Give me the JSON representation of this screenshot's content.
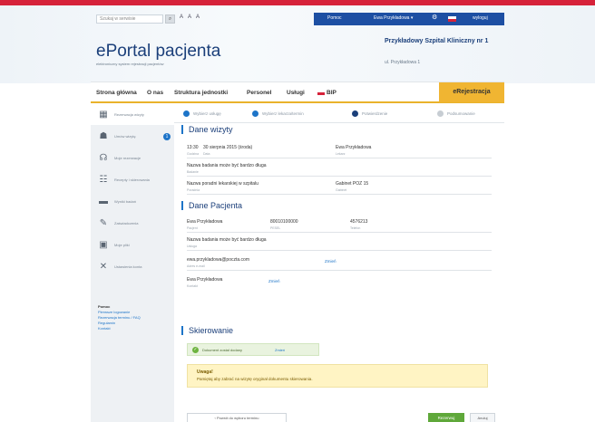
{
  "topbar": {
    "search_placeholder": "Szukaj w serwisie",
    "font_controls": "A  A  A",
    "help_label": "Pomoc",
    "user_label": "Ewa Przykładowa  ▾",
    "logout_label": "wyloguj"
  },
  "header": {
    "title": "ePortal pacjenta",
    "subtitle": "elektroniczny system rejestracji pacjentów",
    "hospital_name": "Przykładowy Szpital Kliniczny nr 1",
    "hospital_address": "ul. Przykładowa 1"
  },
  "nav": {
    "items": [
      "Strona główna",
      "O nas",
      "Struktura jednostki",
      "Personel",
      "Usługi",
      "BIP"
    ],
    "registration": "eRejestracja"
  },
  "sidebar": {
    "items": [
      {
        "label": "Rezerwacja wizyty",
        "icon": "calendar-icon"
      },
      {
        "label": "Umów wizytę",
        "icon": "doctor-icon",
        "badge": "1"
      },
      {
        "label": "Moje rezerwacje",
        "icon": "stethoscope-icon"
      },
      {
        "label": "Recepty i skierowania",
        "icon": "prescription-icon"
      },
      {
        "label": "Wyniki badań",
        "icon": "folder-icon"
      },
      {
        "label": "Zaświadczenia",
        "icon": "pen-icon"
      },
      {
        "label": "Moje pliki",
        "icon": "files-icon"
      },
      {
        "label": "Ustawienia konta",
        "icon": "tools-icon"
      }
    ],
    "help": {
      "title": "Pomoc",
      "links": [
        "Pierwsze logowanie",
        "Rezerwacja terminu / FAQ",
        "Regulamin",
        "Kontakt"
      ]
    }
  },
  "steps": [
    {
      "label": "Wybierz usługę",
      "state": "done"
    },
    {
      "label": "Wybierz lekarza/termin",
      "state": "done"
    },
    {
      "label": "Potwierdzenie",
      "state": "current"
    },
    {
      "label": "Podsumowanie",
      "state": "future"
    }
  ],
  "visit": {
    "title": "Dane wizyty",
    "time": "13:30",
    "date": "30 sierpnia 2015 (środa)",
    "time_label": "Godzina",
    "date_label": "Data",
    "doctor": "Ewa Przykładowa",
    "doctor_label": "Lekarz",
    "service": "Nazwa badania może być bardzo długa",
    "service_label": "Badanie",
    "clinic": "Nazwa poradni lekarskiej w szpitalu",
    "clinic_label": "Poradnia",
    "room": "Gabinet POZ 15",
    "room_label": "Gabinet"
  },
  "patient": {
    "title": "Dane Pacjenta",
    "name": "Ewa Przykładowa",
    "name_label": "Pacjent",
    "pesel": "80010100000",
    "pesel_label": "PESEL",
    "phone": "4576213",
    "phone_label": "Telefon",
    "service": "Nazwa badania może być bardzo długa",
    "service_label": "Usługa",
    "email": "ewa.przykladowa@poczta.com",
    "email_label": "Adres e-mail",
    "email_link": "Zmień",
    "contact": "Ewa Przykładowa",
    "contact_label": "Kontakt",
    "contact_link": "Zmień"
  },
  "referral": {
    "title": "Skierowanie",
    "ok_text": "Dokument został dodany",
    "ok_link": "Zmień",
    "warn_title": "Uwaga!",
    "warn_text": "Pamiętaj aby zabrać na wizytę oryginał dokumentu skierowania."
  },
  "actions": {
    "back": "‹  Powrót do wyboru terminu",
    "next": "Rezerwuj",
    "cancel": "Anuluj"
  }
}
